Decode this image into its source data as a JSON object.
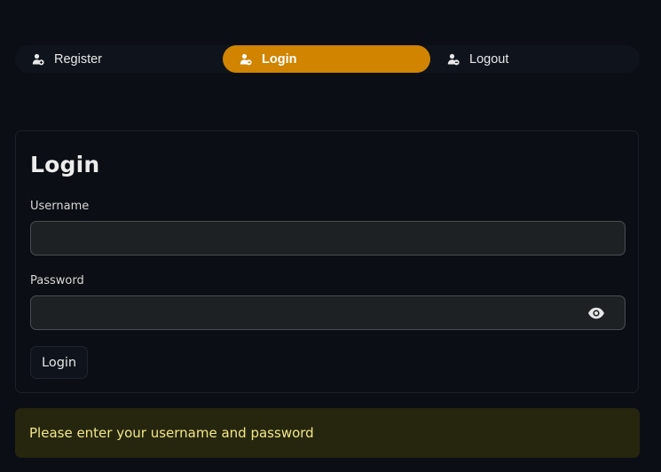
{
  "nav": {
    "items": [
      {
        "label": "Register",
        "icon": "person-add-icon",
        "active": false
      },
      {
        "label": "Login",
        "icon": "person-login-icon",
        "active": true
      },
      {
        "label": "Logout",
        "icon": "person-remove-icon",
        "active": false
      }
    ],
    "active_color": "#d08400"
  },
  "login_form": {
    "title": "Login",
    "username_label": "Username",
    "username_value": "",
    "password_label": "Password",
    "password_value": "",
    "password_toggle_icon": "eye-icon",
    "submit_label": "Login"
  },
  "alert": {
    "message": "Please enter your username and password",
    "text_color": "#f1e886",
    "background_color": "#26260f"
  }
}
